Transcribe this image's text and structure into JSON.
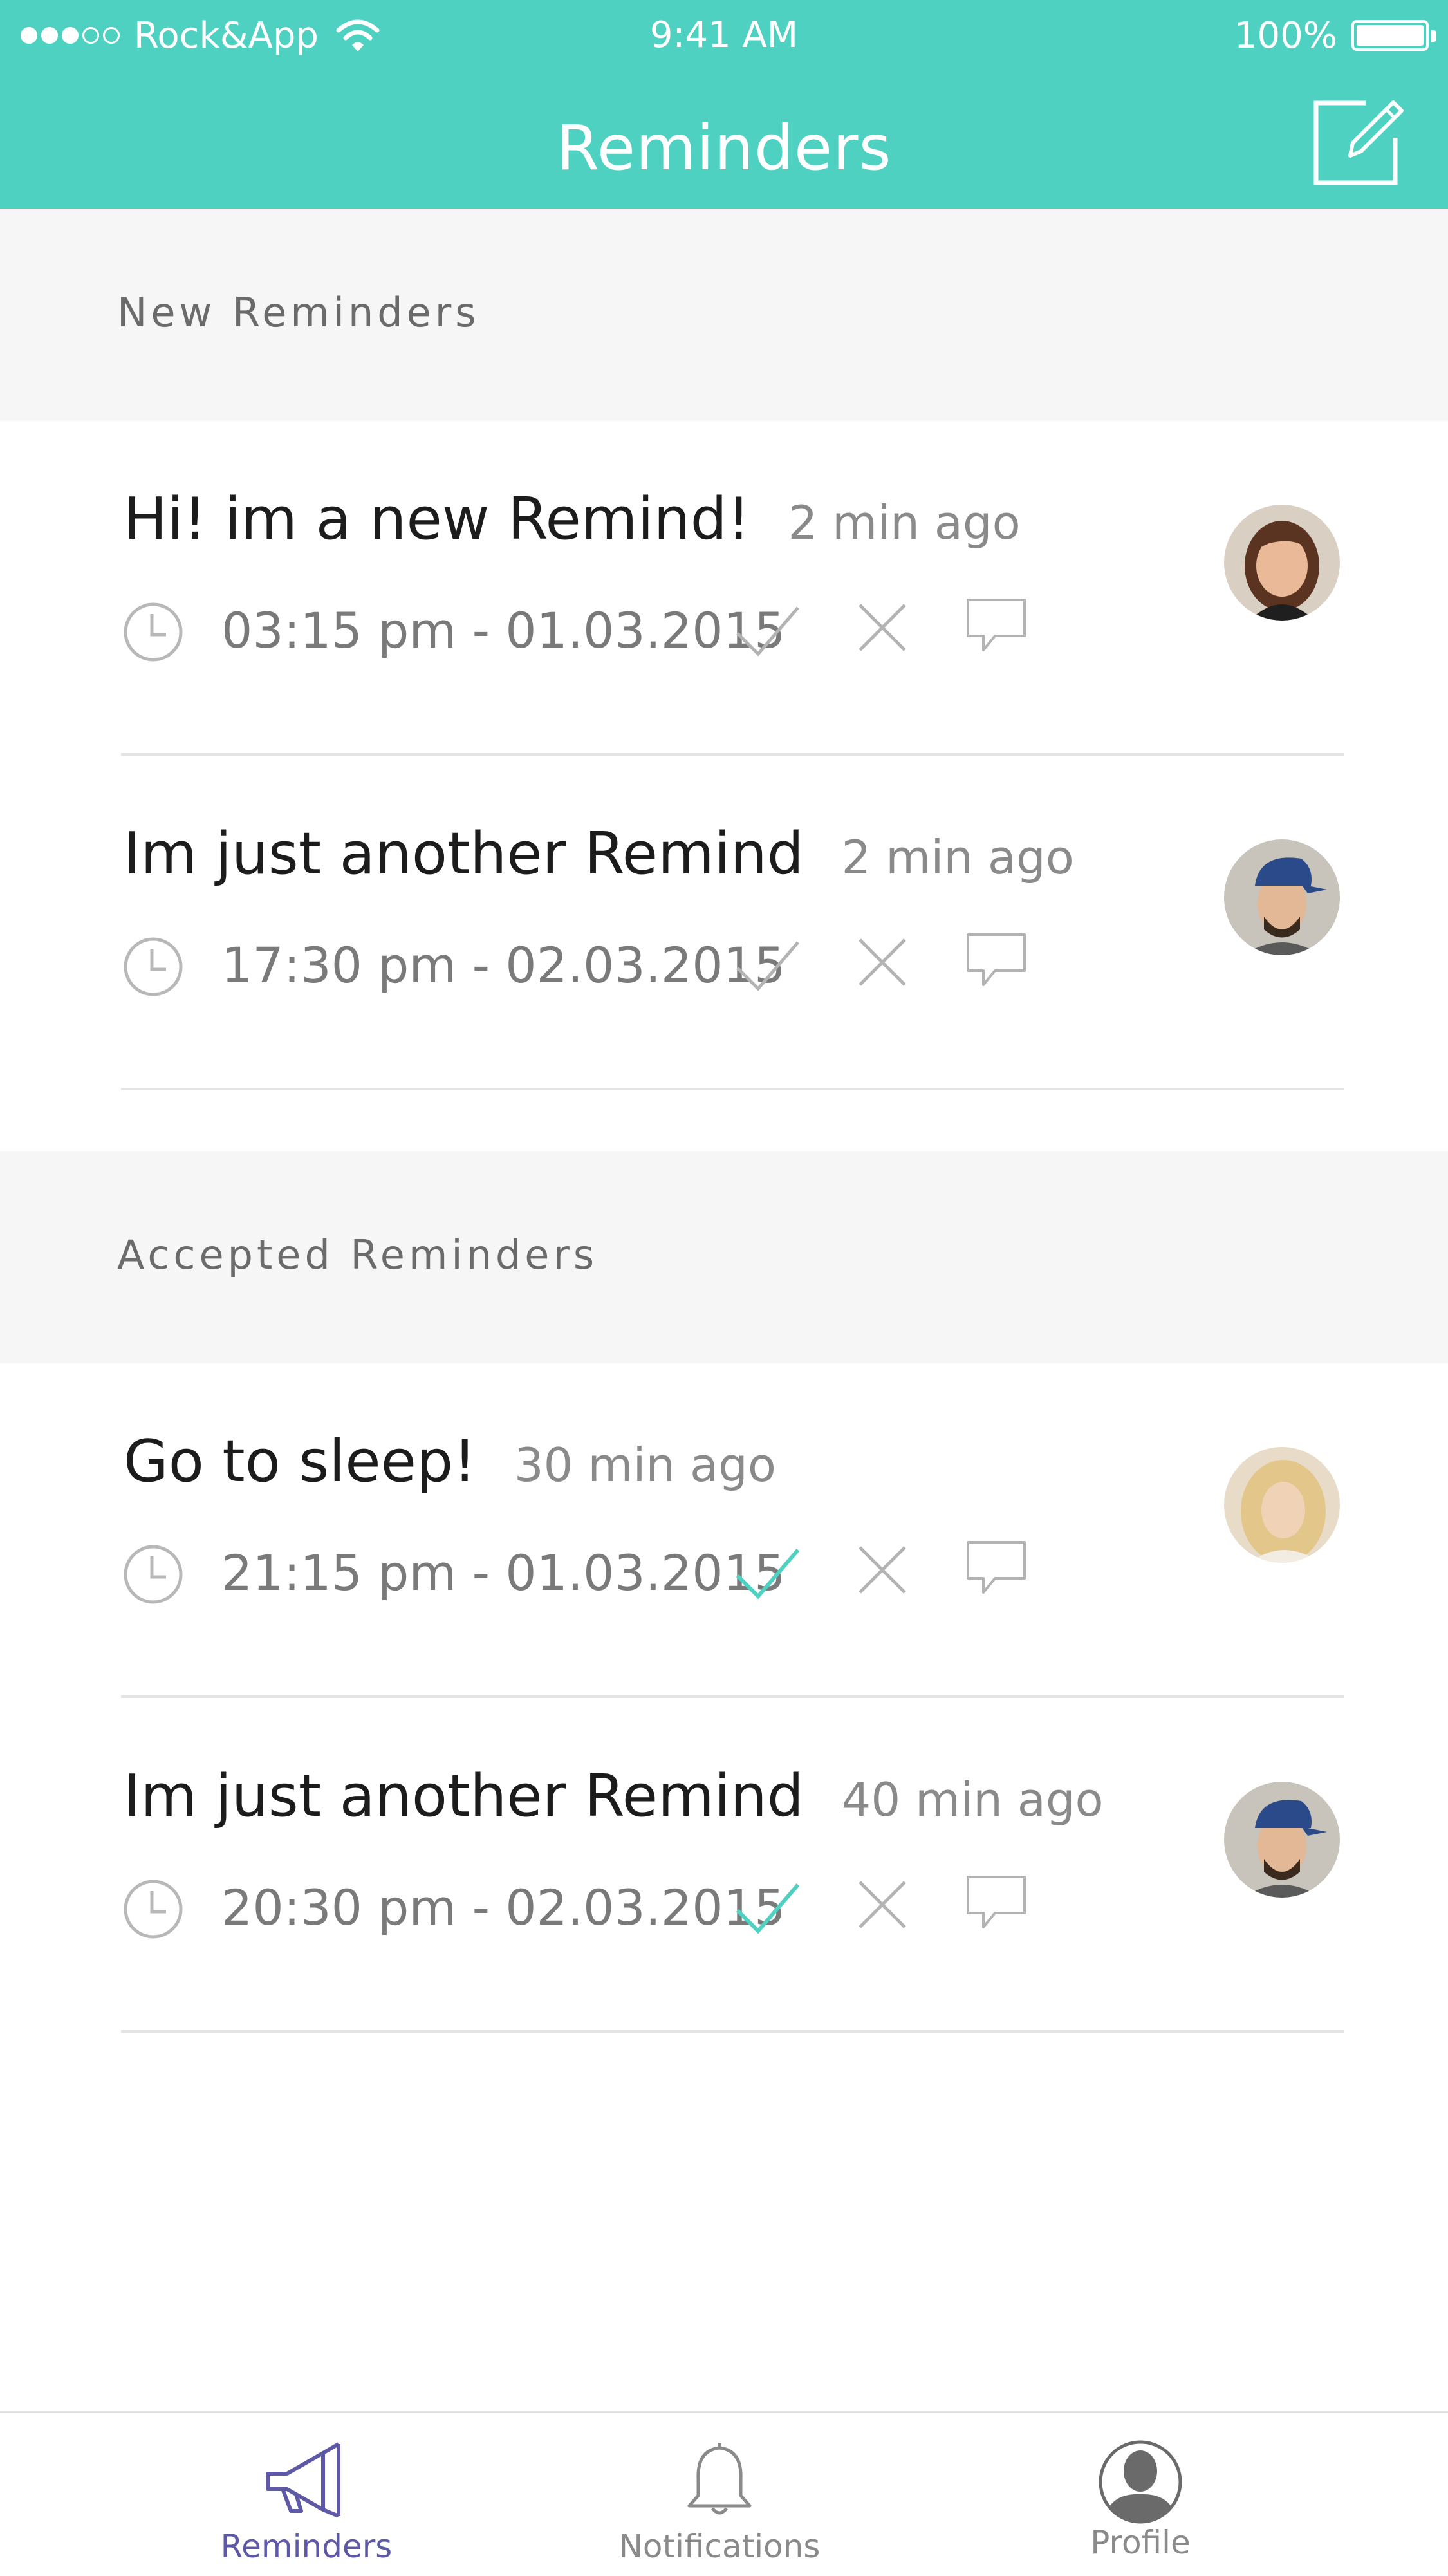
{
  "status_bar": {
    "carrier": "Rock&App",
    "time": "9:41 AM",
    "battery": "100%"
  },
  "header": {
    "title": "Reminders",
    "compose_icon": "compose-icon"
  },
  "sections": [
    {
      "label": "New Reminders",
      "items": [
        {
          "title": "Hi! im a new Remind!",
          "ago": "2 min ago",
          "time": "03:15 pm - 01.03.2015",
          "accepted": false
        },
        {
          "title": "Im just another Remind",
          "ago": "2 min ago",
          "time": "17:30 pm - 02.03.2015",
          "accepted": false
        }
      ]
    },
    {
      "label": "Accepted Reminders",
      "items": [
        {
          "title": "Go to sleep!",
          "ago": "30 min ago",
          "time": "21:15 pm - 01.03.2015",
          "accepted": true
        },
        {
          "title": "Im just another Remind",
          "ago": "40 min ago",
          "time": "20:30 pm - 02.03.2015",
          "accepted": true
        }
      ]
    }
  ],
  "tabbar": {
    "tabs": [
      {
        "label": "Reminders",
        "icon": "megaphone-icon",
        "active": true
      },
      {
        "label": "Notifications",
        "icon": "bell-icon",
        "active": false
      },
      {
        "label": "Profile",
        "icon": "profile-icon",
        "active": false
      }
    ]
  },
  "colors": {
    "accent": "#4fd1c1",
    "tab_active": "#5e59a6",
    "tab_inactive": "#8a8a8a",
    "section_bg": "#f6f6f6"
  }
}
